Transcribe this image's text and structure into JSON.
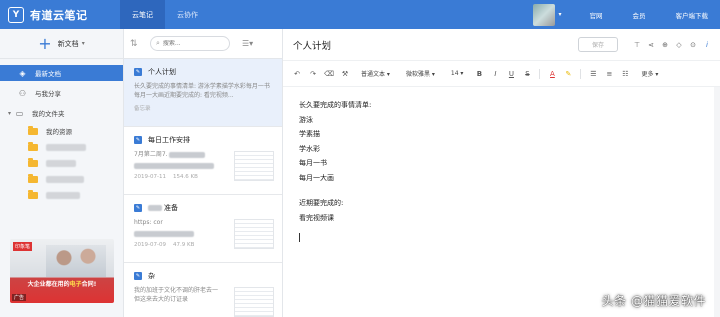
{
  "app": {
    "name": "有道云笔记",
    "logo_glyph": "Y"
  },
  "top_tabs": [
    "云笔记",
    "云协作"
  ],
  "top_links": [
    "官网",
    "会员",
    "客户端下载"
  ],
  "sidebar": {
    "new_doc_label": "新文档",
    "nav": [
      {
        "label": "最新文档",
        "icon": "stack-icon",
        "active": true
      },
      {
        "label": "与我分享",
        "icon": "people-icon",
        "active": false
      },
      {
        "label": "我的文件夹",
        "icon": "folder-icon",
        "active": false
      }
    ],
    "folders": [
      "我的资源"
    ],
    "ad": {
      "logo": "印象笔",
      "line1": "大企业都在用的",
      "highlight": "电子",
      "line2": "合同!",
      "tag": "广告"
    }
  },
  "list": {
    "search_placeholder": "搜索...",
    "notes": [
      {
        "title": "个人计划",
        "snippet": "长久要完成的事情清单: 游泳学素描学水彩每月一书每月一大画近期要完成的: 看完视频...",
        "meta": "备忘录",
        "size": "",
        "active": true,
        "thumb": false
      },
      {
        "title": "每日工作安排",
        "snippet": "7月第二周7.",
        "meta": "2019-07-11",
        "size": "154.6 KB",
        "active": false,
        "thumb": true
      },
      {
        "title": "准备",
        "snippet": "https: cor",
        "meta": "2019-07-09",
        "size": "47.9 KB",
        "active": false,
        "thumb": true
      },
      {
        "title": "杂",
        "snippet": "我的加班于文化不调的肝老去一 但这来去大的订证录",
        "meta": "",
        "size": "",
        "active": false,
        "thumb": true
      }
    ]
  },
  "editor": {
    "title": "个人计划",
    "save_label": "保存",
    "toolbar": {
      "para": "普通文本",
      "font": "微软雅黑",
      "size": "14",
      "more": "更多"
    },
    "lines": [
      "长久要完成的事情清单:",
      "游泳",
      "学素描",
      "学水彩",
      "每月一书",
      "每月一大画",
      "",
      "近期要完成的:",
      "看完视频课"
    ]
  },
  "watermark": "头条 @猫猫爱软件",
  "colors": {
    "brand": "#3a7bd5",
    "folder": "#f5b731"
  }
}
